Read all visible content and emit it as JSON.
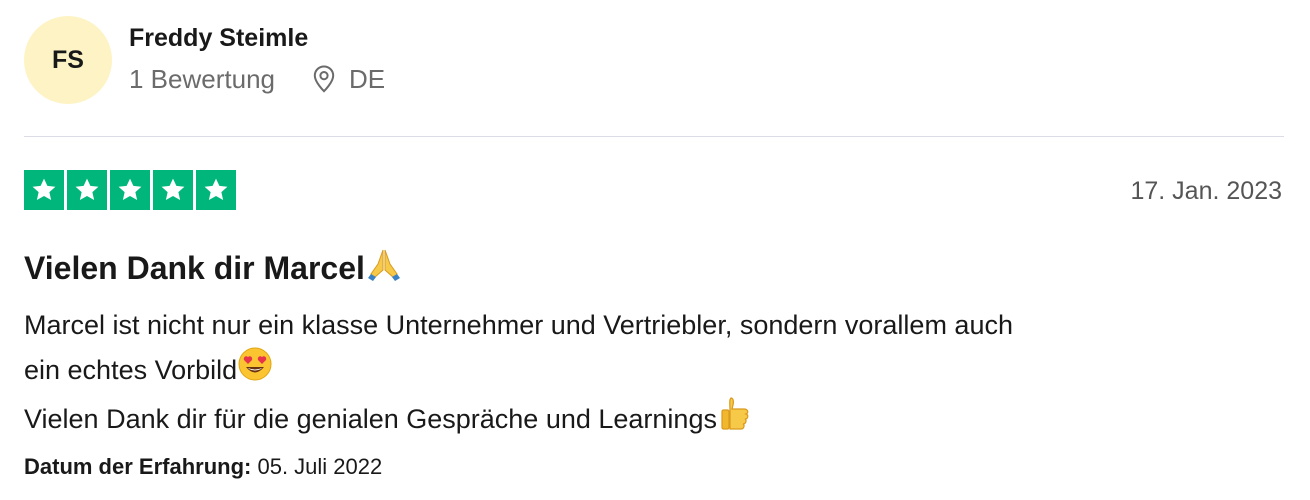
{
  "reviewer": {
    "initials": "FS",
    "name": "Freddy Steimle",
    "review_count": "1 Bewertung",
    "location_icon": "location-pin-icon",
    "country": "DE",
    "avatar_color": "#fdf3c4"
  },
  "review": {
    "rating": 5,
    "star_color": "#00b67a",
    "date": "17. Jan. 2023",
    "title": "Vielen Dank dir Marcel",
    "title_emoji": "folded-hands-emoji",
    "body_line1": "Marcel ist nicht nur ein klasse Unternehmer und Vertriebler, sondern vorallem auch",
    "body_line2": "ein echtes Vorbild",
    "body_line2_emoji": "heart-eyes-emoji",
    "body_line3": "Vielen Dank dir für die genialen Gespräche und Learnings",
    "body_line3_emoji": "thumbs-up-emoji",
    "experience_label": "Datum der Erfahrung:",
    "experience_date": "05. Juli 2022"
  }
}
